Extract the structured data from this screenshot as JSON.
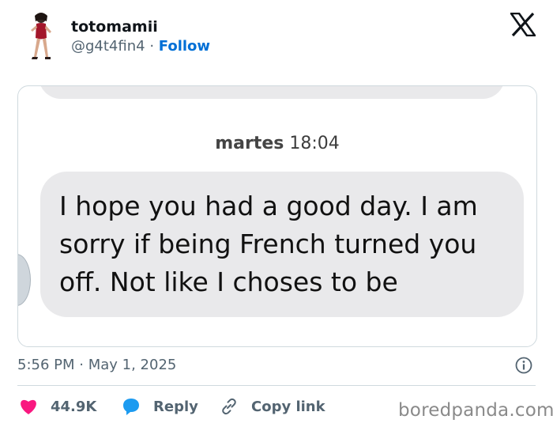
{
  "user": {
    "display_name": "totomamii",
    "handle": "@g4t4fin4",
    "separator": " · ",
    "follow_label": "Follow"
  },
  "chat": {
    "day": "martes",
    "time": "18:04",
    "message": "I hope you had a good day. I am sorry if being French turned you off. Not like I choses to be"
  },
  "tweet": {
    "time": "5:56 PM",
    "separator": " · ",
    "date": "May 1, 2025"
  },
  "actions": {
    "likes": "44.9K",
    "reply_label": "Reply",
    "copy_link_label": "Copy link"
  },
  "watermark": "boredpanda.com",
  "colors": {
    "link_blue": "#006fd6",
    "heart": "#f91880",
    "reply_icon": "#1d9bf0",
    "bubble_gray": "#e9e9eb",
    "muted_text": "#536471"
  },
  "icons": [
    "x-logo-icon",
    "info-icon",
    "heart-icon",
    "reply-bubble-icon",
    "link-icon"
  ]
}
